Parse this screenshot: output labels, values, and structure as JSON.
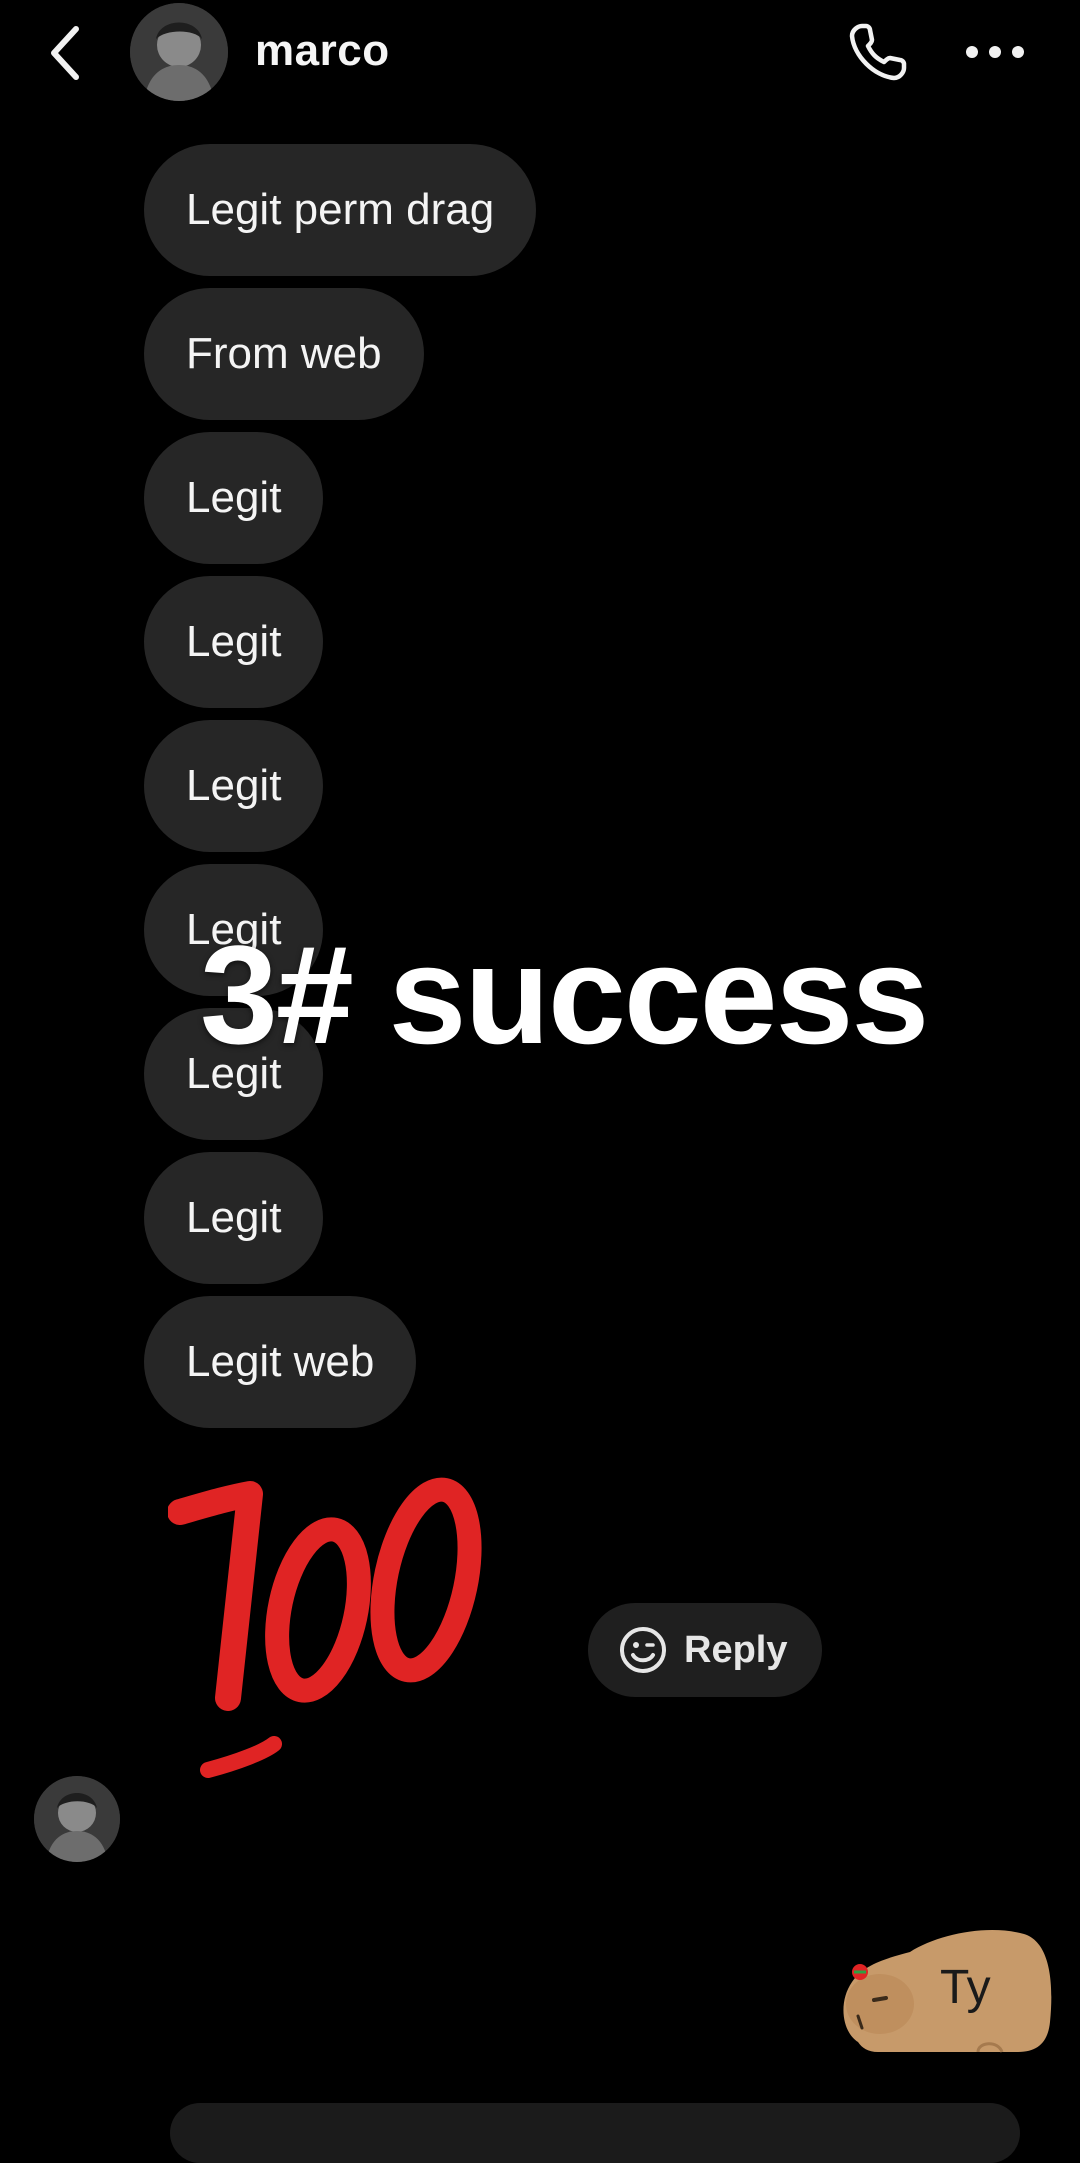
{
  "header": {
    "back_icon": "chevron-left-icon",
    "username": "marco",
    "call_icon": "phone-icon",
    "more_icon": "more-horizontal-icon"
  },
  "messages": [
    {
      "text": "Legit perm drag"
    },
    {
      "text": "From web"
    },
    {
      "text": "Legit"
    },
    {
      "text": "Legit"
    },
    {
      "text": "Legit"
    },
    {
      "text": "Legit"
    },
    {
      "text": "Legit"
    },
    {
      "text": "Legit"
    },
    {
      "text": "Legit web"
    }
  ],
  "overlay": {
    "caption": "3# success"
  },
  "emoji_message": {
    "icon": "hundred-points-icon",
    "color": "#e02424"
  },
  "reply_button": {
    "icon": "smiley-icon",
    "label": "Reply"
  },
  "sent_sticker": {
    "icon": "capybara-sticker-icon",
    "text": "Ty",
    "color": "#c79a6a"
  },
  "colors": {
    "background": "#000000",
    "bubble": "#262626",
    "text": "#f4f4f4"
  }
}
